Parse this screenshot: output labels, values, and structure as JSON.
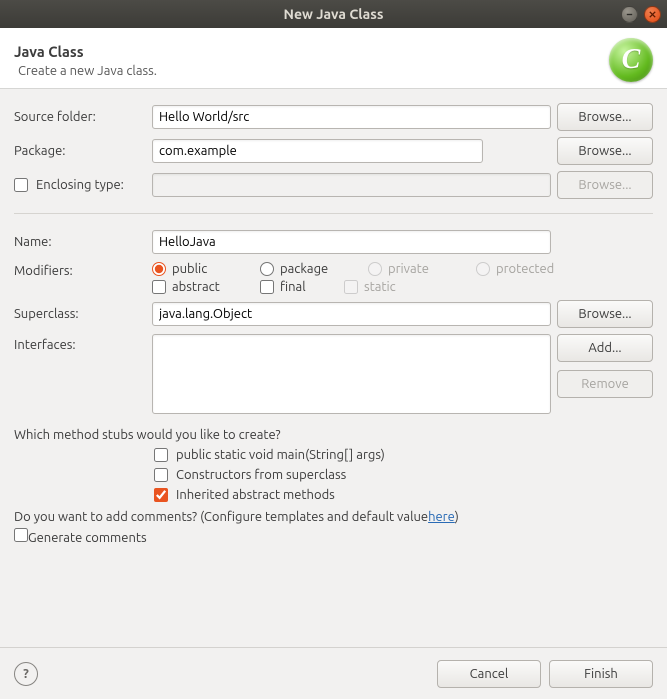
{
  "window": {
    "title": "New Java Class"
  },
  "header": {
    "title": "Java Class",
    "subtitle": "Create a new Java class.",
    "icon_letter": "C"
  },
  "labels": {
    "source_folder": "Source folder:",
    "package": "Package:",
    "enclosing_type": "Enclosing type:",
    "name": "Name:",
    "modifiers": "Modifiers:",
    "superclass": "Superclass:",
    "interfaces": "Interfaces:",
    "stubs_question": "Which method stubs would you like to create?",
    "comments_question": "Do you want to add comments? (Configure templates and default value ",
    "comments_link": "here",
    "comments_tail": ")"
  },
  "values": {
    "source_folder": "Hello World/src",
    "package": "com.example",
    "enclosing_type": "",
    "name": "HelloJava",
    "superclass": "java.lang.Object"
  },
  "buttons": {
    "browse": "Browse...",
    "add": "Add...",
    "remove": "Remove",
    "cancel": "Cancel",
    "finish": "Finish"
  },
  "modifiers": {
    "public": "public",
    "package": "package",
    "private": "private",
    "protected": "protected",
    "abstract": "abstract",
    "final": "final",
    "static": "static"
  },
  "stubs": {
    "main": "public static void main(String[] args)",
    "constructors": "Constructors from superclass",
    "inherited": "Inherited abstract methods"
  },
  "generate_comments": "Generate comments",
  "state": {
    "enclosing_checked": false,
    "modifier_radio": "public",
    "abstract_checked": false,
    "final_checked": false,
    "static_checked": false,
    "stub_main": false,
    "stub_constructors": false,
    "stub_inherited": true,
    "generate_comments": false
  }
}
